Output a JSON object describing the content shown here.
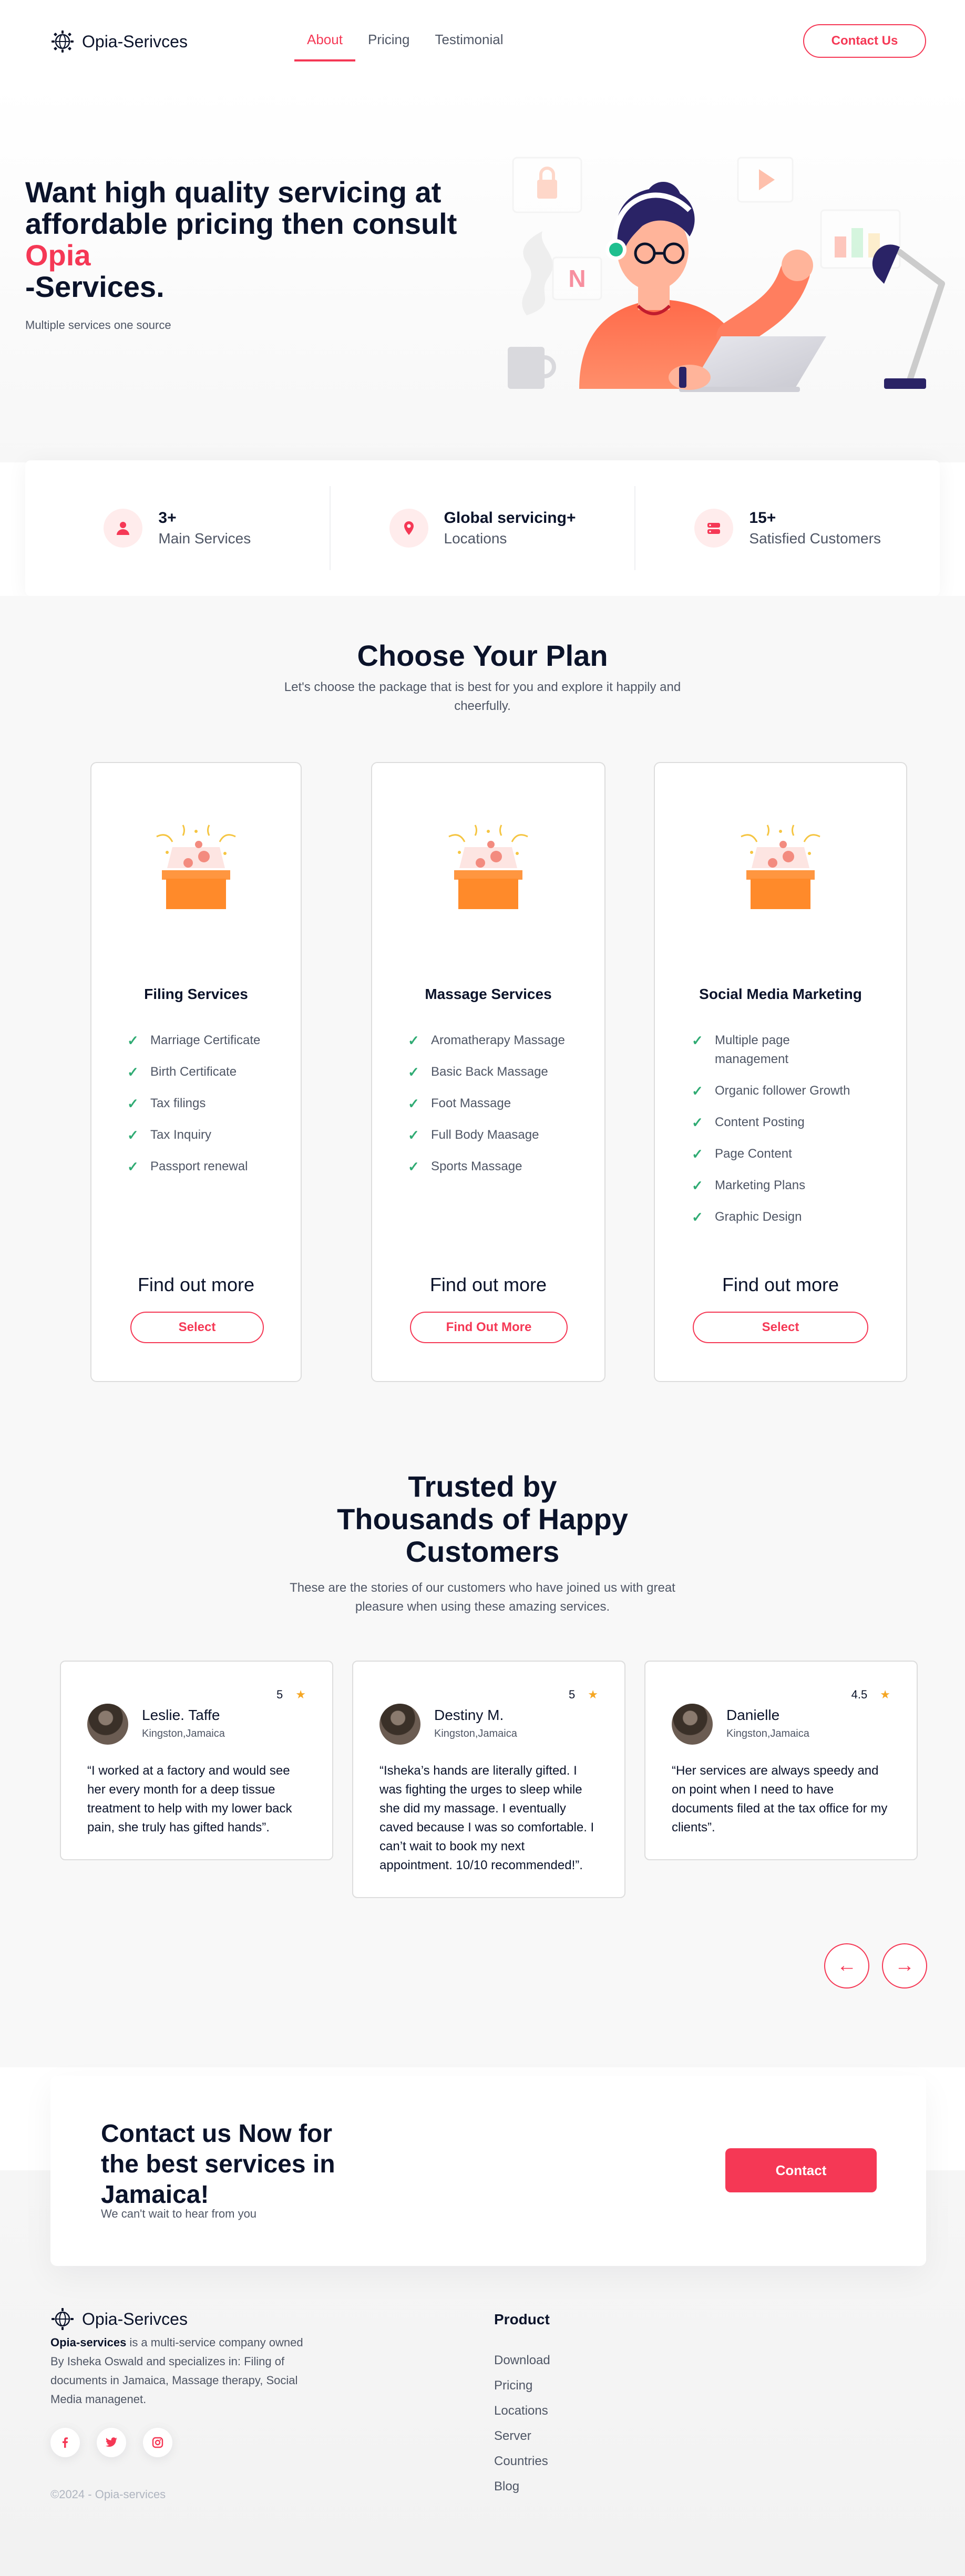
{
  "colors": {
    "accent": "#f53855",
    "text": "#0b132a",
    "muted": "#4f5665",
    "check": "#2fab73",
    "star": "#f5a623"
  },
  "nav": {
    "logo": "Opia-Serivces",
    "links": [
      "About",
      "Pricing",
      "Testimonial"
    ],
    "active_link": "About",
    "cta": "Contact Us"
  },
  "hero": {
    "title_line1": "Want high quality servicing at affordable pricing then consult",
    "title_accent": "Opia",
    "title_line2": "-Services.",
    "subtitle": "Multiple services one source",
    "illustration": "support-agent-at-laptop-illustration"
  },
  "stats": [
    {
      "icon": "user-icon",
      "value": "3+",
      "label": "Main Services"
    },
    {
      "icon": "location-pin-icon",
      "value": "Global servicing+",
      "label": "Locations"
    },
    {
      "icon": "server-icon",
      "value": "15+",
      "label": "Satisfied Customers"
    }
  ],
  "plans": {
    "title": "Choose Your Plan",
    "subtitle": "Let's choose the package that is best for you and explore it happily and cheerfully.",
    "cards": [
      {
        "name": "Filing Services",
        "features": [
          "Marriage Certificate",
          "Birth Certificate",
          "Tax filings",
          "Tax Inquiry",
          "Passport renewal"
        ],
        "more": "Find out more",
        "button": "Select"
      },
      {
        "name": "Massage Services",
        "features": [
          "Aromatherapy Massage",
          "Basic Back Massage",
          "Foot Massage",
          "Full Body Maasage",
          "Sports Massage"
        ],
        "more": "Find out more",
        "button": "Find Out More"
      },
      {
        "name": "Social Media Marketing",
        "features": [
          "Multiple page management",
          "Organic follower Growth",
          "Content Posting",
          "Page Content",
          "Marketing Plans",
          "Graphic Design"
        ],
        "more": "Find out more",
        "button": "Select"
      }
    ]
  },
  "testimonials": {
    "title_lines": [
      "Trusted by",
      "Thousands of Happy",
      "Customers"
    ],
    "subtitle": "These are the stories of our customers who have joined us with great pleasure when using these amazing services.",
    "reviews": [
      {
        "name": "Leslie. Taffe",
        "location": "Kingston,Jamaica",
        "rating": "5",
        "text": "“I worked at a factory and would see her every month for a deep tissue treatment to help with my lower back pain, she truly has gifted hands”."
      },
      {
        "name": "Destiny M.",
        "location": "Kingston,Jamaica",
        "rating": "5",
        "text": "“Isheka’s hands are literally gifted. I was fighting the urges to sleep while she did my massage. I eventually caved because I was so comfortable. I can’t wait to book my next appointment. 10/10 recommended!”."
      },
      {
        "name": "Danielle",
        "location": "Kingston,Jamaica",
        "rating": "4.5",
        "text": "“Her services are always speedy and on point when I need to have documents filed at the tax office for my clients”."
      }
    ],
    "prev_icon": "←",
    "next_icon": "→"
  },
  "cta": {
    "title": "Contact us Now for the best services in Jamaica!",
    "subtitle": "We can't wait to hear from you",
    "button": "Contact"
  },
  "footer": {
    "logo": "Opia-Serivces",
    "desc_brand": "Opia-services",
    "desc_rest": " is a multi-service company owned By Isheka Oswald and specializes in: Filing of documents in Jamaica, Massage therapy, Social Media managenet.",
    "socials": [
      "facebook-icon",
      "twitter-icon",
      "instagram-icon"
    ],
    "copyright": "©2024 - Opia-services",
    "product_title": "Product",
    "product_links": [
      "Download",
      "Pricing",
      "Locations",
      "Server",
      "Countries",
      "Blog"
    ]
  }
}
